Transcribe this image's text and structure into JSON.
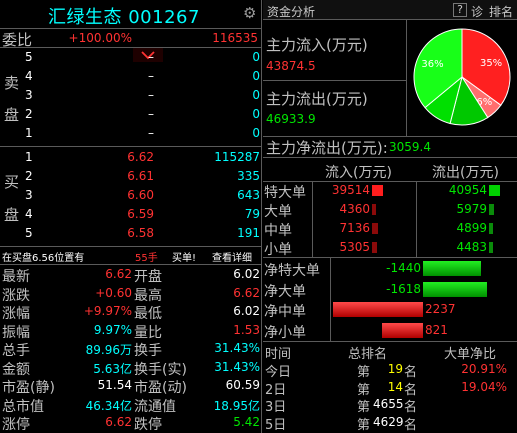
{
  "header": {
    "stock_title": "汇绿生态 001267",
    "gear_icon": "gear-icon"
  },
  "weibi": {
    "label": "委比",
    "ratio": "+100.00%",
    "diff": "116535"
  },
  "sell_side_label": [
    "卖",
    "盘"
  ],
  "buy_side_label": [
    "买",
    "盘"
  ],
  "sell_orders": [
    {
      "level": "5",
      "price": "–",
      "volume": "0"
    },
    {
      "level": "4",
      "price": "–",
      "volume": "0"
    },
    {
      "level": "3",
      "price": "–",
      "volume": "0"
    },
    {
      "level": "2",
      "price": "–",
      "volume": "0"
    },
    {
      "level": "1",
      "price": "–",
      "volume": "0"
    }
  ],
  "buy_orders": [
    {
      "level": "1",
      "price": "6.62",
      "volume": "115287"
    },
    {
      "level": "2",
      "price": "6.61",
      "volume": "335"
    },
    {
      "level": "3",
      "price": "6.60",
      "volume": "643"
    },
    {
      "level": "4",
      "price": "6.59",
      "volume": "79"
    },
    {
      "level": "5",
      "price": "6.58",
      "volume": "191"
    }
  ],
  "status": {
    "text": "在买盘6.56位置有",
    "hands": "55手",
    "action": "买单!",
    "detail_link": "查看详细"
  },
  "stats": [
    {
      "k1": "最新",
      "v1": "6.62",
      "c1": "red",
      "k2": "开盘",
      "v2": "6.02",
      "c2": "white"
    },
    {
      "k1": "涨跌",
      "v1": "+0.60",
      "c1": "red",
      "k2": "最高",
      "v2": "6.62",
      "c2": "red"
    },
    {
      "k1": "涨幅",
      "v1": "+9.97%",
      "c1": "red",
      "k2": "最低",
      "v2": "6.02",
      "c2": "white"
    },
    {
      "k1": "振幅",
      "v1": "9.97%",
      "c1": "cyan",
      "k2": "量比",
      "v2": "1.53",
      "c2": "red"
    },
    {
      "k1": "总手",
      "v1": "89.96万",
      "c1": "cyan",
      "k2": "换手",
      "v2": "31.43%",
      "c2": "cyan"
    },
    {
      "k1": "金额",
      "v1": "5.63亿",
      "c1": "cyan",
      "k2": "换手(实)",
      "v2": "31.43%",
      "c2": "cyan"
    },
    {
      "k1": "市盈(静)",
      "v1": "51.54",
      "c1": "white",
      "k2": "市盈(动)",
      "v2": "60.59",
      "c2": "white"
    },
    {
      "k1": "总市值",
      "v1": "46.34亿",
      "c1": "cyan",
      "k2": "流通值",
      "v2": "18.95亿",
      "c2": "cyan"
    },
    {
      "k1": "涨停",
      "v1": "6.62",
      "c1": "red",
      "k2": "跌停",
      "v2": "5.42",
      "c2": "green"
    }
  ],
  "right_header": {
    "title": "资金分析",
    "help": "?",
    "diagnose": "诊",
    "rank": "排名"
  },
  "flows": {
    "inflow_label": "主力流入(万元)",
    "inflow_value": "43874.5",
    "outflow_label": "主力流出(万元)",
    "outflow_value": "46933.9",
    "net_label": "主力净流出(万元):",
    "net_value": "3059.4"
  },
  "pie": {
    "slices": [
      {
        "label": "35%",
        "value": 35,
        "color": "#ff2020"
      },
      {
        "label": "6%",
        "value": 6,
        "color": "#ff6e6e"
      },
      {
        "label": "",
        "value": 13,
        "color": "#00c800"
      },
      {
        "label": "",
        "value": 10,
        "color": "#00e000"
      },
      {
        "label": "36%",
        "value": 36,
        "color": "#18ff18"
      }
    ]
  },
  "flow_table": {
    "col_in": "流入(万元)",
    "col_out": "流出(万元)",
    "rows": [
      {
        "name": "特大单",
        "in": "39514",
        "out": "40954",
        "in_level": 1.0,
        "out_level": 1.0
      },
      {
        "name": "大单",
        "in": "4360",
        "out": "5979",
        "in_level": 0.4,
        "out_level": 0.45
      },
      {
        "name": "中单",
        "in": "7136",
        "out": "4899",
        "in_level": 0.55,
        "out_level": 0.4
      },
      {
        "name": "小单",
        "in": "5305",
        "out": "4483",
        "in_level": 0.45,
        "out_level": 0.35
      }
    ]
  },
  "net_table": {
    "rows": [
      {
        "name": "净特大单",
        "value": "-1440",
        "sign": "neg",
        "level": 0.9
      },
      {
        "name": "净大单",
        "value": "-1618",
        "sign": "neg",
        "level": 1.0
      },
      {
        "name": "净中单",
        "value": "2237",
        "sign": "pos",
        "level": 1.0
      },
      {
        "name": "净小单",
        "value": "821",
        "sign": "pos",
        "level": 0.45
      }
    ]
  },
  "rank_table": {
    "col_time": "时间",
    "col_rank": "总排名",
    "col_net": "大单净比",
    "di": "第",
    "ming": "名",
    "rows": [
      {
        "time": "今日",
        "rank": "19",
        "ratio": "20.91%"
      },
      {
        "time": "2日",
        "rank": "14",
        "ratio": "19.04%"
      },
      {
        "time": "3日",
        "rank": "4655",
        "ratio": ""
      },
      {
        "time": "5日",
        "rank": "4629",
        "ratio": ""
      }
    ]
  }
}
